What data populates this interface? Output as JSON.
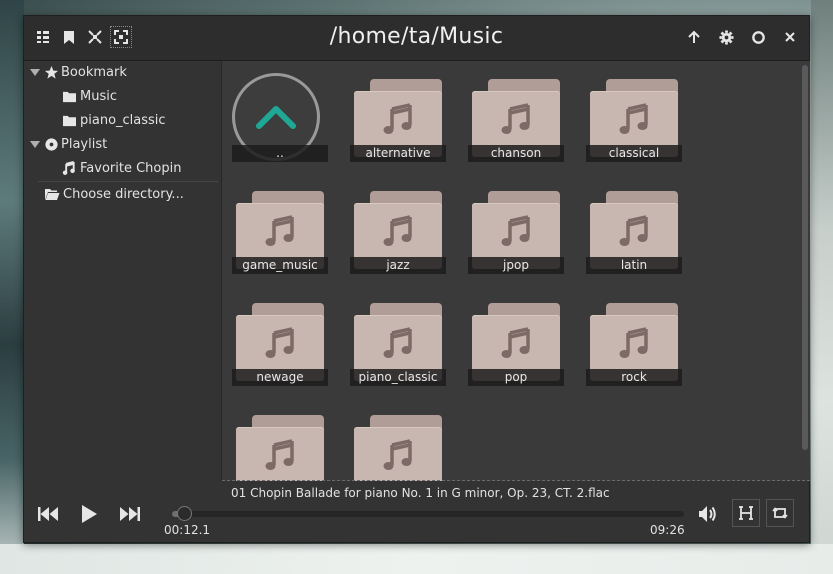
{
  "window": {
    "title": "/home/ta/Music"
  },
  "sidebar": {
    "bookmark_label": "Bookmark",
    "bookmarks": [
      "Music",
      "piano_classic"
    ],
    "playlist_label": "Playlist",
    "playlists": [
      "Favorite Chopin"
    ],
    "choose_directory": "Choose directory..."
  },
  "folders": {
    "parent": "..",
    "items": [
      "alternative",
      "chanson",
      "classical",
      "game_music",
      "jazz",
      "jpop",
      "latin",
      "newage",
      "piano_classic",
      "pop",
      "rock",
      "",
      ""
    ]
  },
  "player": {
    "now_playing": "01 Chopin Ballade for piano No. 1 in G minor, Op. 23, CT. 2.flac",
    "current_time": "00:12.1",
    "total_time": "09:26",
    "progress": 0.021
  },
  "colors": {
    "accent": "#1fa896",
    "folder": "#c8b6b0",
    "note": "#7d6a66"
  }
}
